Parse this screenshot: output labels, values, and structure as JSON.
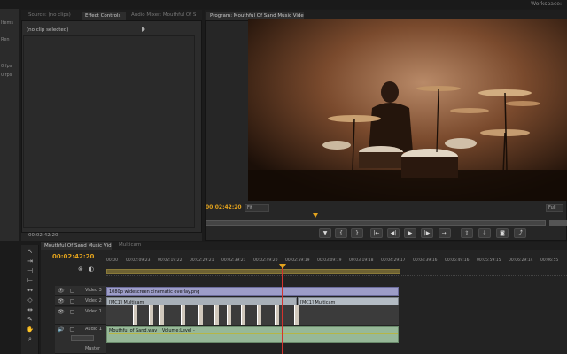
{
  "workspace": {
    "label": "Workspace:"
  },
  "left_strip": {
    "items": [
      "Items",
      "Ren",
      "0 fps",
      "0 fps"
    ]
  },
  "source_panel": {
    "tabs": [
      "Source: (no clips)",
      "Effect Controls",
      "Audio Mixer: Mouthful Of S"
    ],
    "active_tab": "Effect Controls",
    "no_clip_text": "(no clip selected)",
    "timecode": "00:02:42:20"
  },
  "program_panel": {
    "tab": "Program: Mouthful Of Sand Music Video",
    "timecode": "00:02:42:20",
    "fit": "Fit",
    "right_select": "Full",
    "controls": [
      "mark-in",
      "mark-out",
      "go-to-in",
      "step-back",
      "play",
      "step-forward",
      "go-to-out",
      "lift",
      "extract",
      "export-frame",
      "trim"
    ],
    "control_glyphs": [
      "▼",
      "{",
      "}",
      "|←",
      "◀|",
      "▶",
      "|▶",
      "→|",
      "⇧",
      "⇩",
      "◙",
      "⤴"
    ]
  },
  "timeline": {
    "tabs": [
      "Mouthful Of Sand Music Video",
      "Multicam"
    ],
    "active_tab": "Mouthful Of Sand Music Video",
    "timecode": "00:02:42:20",
    "ruler_labels": [
      "00:00",
      "00:02:09:23",
      "00:02:19:22",
      "00:02:29:21",
      "00:02:39:21",
      "00:02:49:20",
      "00:02:59:19",
      "00:03:09:19",
      "00:03:19:18",
      "00:04:29:17",
      "00:04:39:16",
      "00:05:49:16",
      "00:05:59:15",
      "00:06:29:14",
      "00:06:55"
    ],
    "tracks": [
      {
        "name": "Video 3",
        "clip": "1080p widescreen cinematic overlay.png"
      },
      {
        "name": "Video 2",
        "clip": "[MC1] Multicam",
        "clip2": "[MC1] Multicam"
      },
      {
        "name": "Video 1"
      },
      {
        "name": "Audio 1",
        "clip": "Mouthful of Sand.wav",
        "clip_extra": "Volume:Level -"
      },
      {
        "name": "Master"
      }
    ]
  },
  "tools": [
    "selection-tool",
    "track-select-tool",
    "ripple-edit-tool",
    "rolling-edit-tool",
    "rate-stretch-tool",
    "razor-tool",
    "slip-tool",
    "slide-tool",
    "pen-tool",
    "hand-tool",
    "zoom-tool"
  ],
  "colors": {
    "timecode": "#e3a31d",
    "playhead": "#d3332e",
    "video_clip": "#9d9dc8",
    "audio_clip": "#97b898"
  }
}
